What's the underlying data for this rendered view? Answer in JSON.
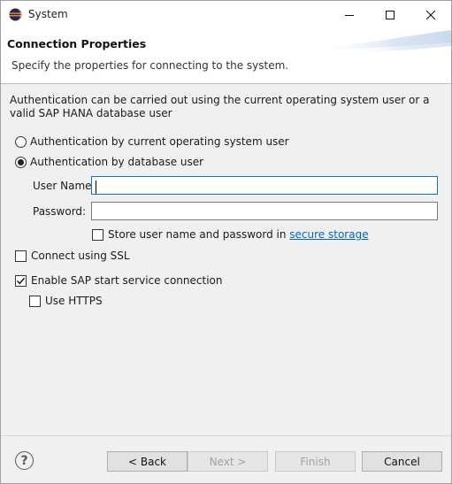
{
  "window": {
    "title": "System",
    "app_icon": "eclipse-icon",
    "controls": {
      "minimize": "minimize-icon",
      "maximize": "maximize-icon",
      "close": "close-icon"
    }
  },
  "banner": {
    "title": "Connection Properties",
    "description": "Specify the properties for connecting to the system."
  },
  "intro_text": "Authentication can be carried out using the current operating system user or a valid SAP HANA database user",
  "auth_options": [
    {
      "label": "Authentication by current operating system user",
      "selected": false
    },
    {
      "label": "Authentication by database user",
      "selected": true
    }
  ],
  "fields": {
    "user_name_label": "User Name:",
    "user_name_value": "",
    "password_label": "Password:",
    "password_value": ""
  },
  "store_credentials": {
    "checked": false,
    "label": "Store user name and password in ",
    "link_text": "secure storage"
  },
  "connect_ssl": {
    "label": "Connect using SSL",
    "checked": false
  },
  "enable_sap_start": {
    "label": "Enable SAP start service connection",
    "checked": true
  },
  "use_https": {
    "label": "Use HTTPS",
    "checked": false
  },
  "buttons": {
    "help_icon": "help-icon",
    "help_glyph": "?",
    "back": "< Back",
    "next": "Next >",
    "finish": "Finish",
    "cancel": "Cancel"
  },
  "colors": {
    "link": "#0066cc",
    "focus_border": "#0078d7"
  }
}
